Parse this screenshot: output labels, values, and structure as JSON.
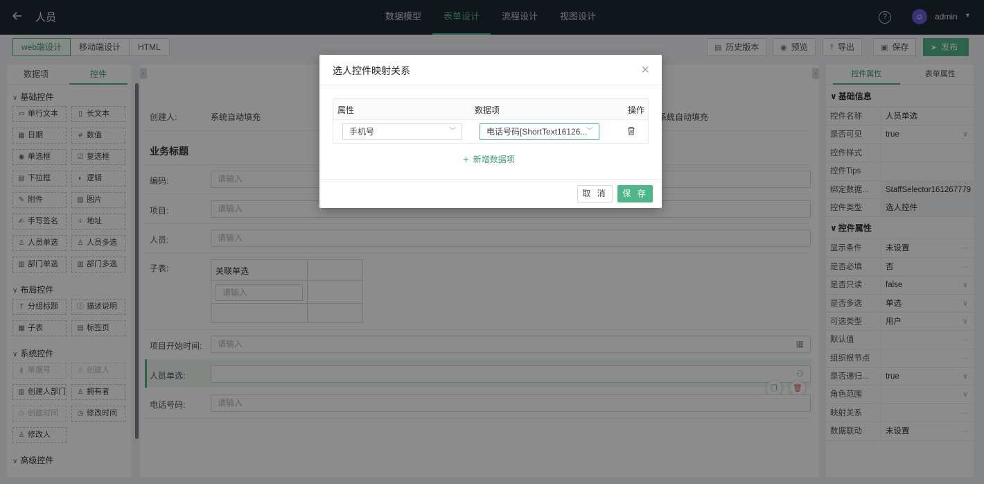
{
  "header": {
    "title": "人员",
    "tabs": [
      "数据模型",
      "表单设计",
      "流程设计",
      "视图设计"
    ],
    "active_tab_index": 1,
    "user": "admin"
  },
  "toolbar": {
    "modes": [
      "web端设计",
      "移动端设计",
      "HTML"
    ],
    "history": "历史版本",
    "preview": "预览",
    "export": "导出",
    "save": "保存",
    "publish": "发布"
  },
  "left_panel": {
    "tabs": [
      "数据项",
      "控件"
    ],
    "groups": [
      {
        "title": "基础控件",
        "items": [
          {
            "label": "单行文本",
            "icon": "text-line-icon"
          },
          {
            "label": "长文本",
            "icon": "text-area-icon"
          },
          {
            "label": "日期",
            "icon": "calendar-icon"
          },
          {
            "label": "数值",
            "icon": "number-icon"
          },
          {
            "label": "单选框",
            "icon": "radio-icon"
          },
          {
            "label": "复选框",
            "icon": "checkbox-icon"
          },
          {
            "label": "下拉框",
            "icon": "dropdown-icon"
          },
          {
            "label": "逻辑",
            "icon": "toggle-icon"
          },
          {
            "label": "附件",
            "icon": "paperclip-icon"
          },
          {
            "label": "图片",
            "icon": "image-icon"
          },
          {
            "label": "手写签名",
            "icon": "pen-icon"
          },
          {
            "label": "地址",
            "icon": "location-icon"
          },
          {
            "label": "人员单选",
            "icon": "person-icon"
          },
          {
            "label": "人员多选",
            "icon": "people-icon"
          },
          {
            "label": "部门单选",
            "icon": "department-icon"
          },
          {
            "label": "部门多选",
            "icon": "departments-icon"
          }
        ]
      },
      {
        "title": "布局控件",
        "items": [
          {
            "label": "分组标题",
            "icon": "heading-icon"
          },
          {
            "label": "描述说明",
            "icon": "info-icon"
          },
          {
            "label": "子表",
            "icon": "table-icon"
          },
          {
            "label": "标签页",
            "icon": "tabs-icon"
          }
        ]
      },
      {
        "title": "系统控件",
        "items": [
          {
            "label": "单据号",
            "icon": "barcode-icon",
            "disabled": true
          },
          {
            "label": "创建人",
            "icon": "person-icon",
            "disabled": true
          },
          {
            "label": "创建人部门",
            "icon": "department-icon"
          },
          {
            "label": "拥有者",
            "icon": "owner-icon"
          },
          {
            "label": "创建时间",
            "icon": "clock-icon",
            "disabled": true
          },
          {
            "label": "修改时间",
            "icon": "clock-edit-icon"
          },
          {
            "label": "修改人",
            "icon": "person-icon"
          }
        ]
      },
      {
        "title": "高级控件",
        "items": []
      }
    ]
  },
  "canvas": {
    "creator_label": "创建人:",
    "creator_value": "系统自动填充",
    "creator_value_right": "系统自动填充",
    "section_title": "业务标题",
    "code_label": "编码:",
    "project_label": "项目:",
    "person_label": "人员:",
    "subtable_label": "子表:",
    "subtable_header": "关联单选",
    "start_time_label": "项目开始时间:",
    "staff_single_label": "人员单选:",
    "phone_label": "电话号码:",
    "placeholder": "请输入"
  },
  "right_panel": {
    "tabs": [
      "控件属性",
      "表单属性"
    ],
    "sections": [
      {
        "title": "基础信息",
        "rows": [
          {
            "key": "控件名称",
            "value": "人员单选"
          },
          {
            "key": "是否可见",
            "value": "true",
            "suffix": "chevron"
          },
          {
            "key": "控件样式",
            "value": ""
          },
          {
            "key": "控件Tips",
            "value": ""
          },
          {
            "key": "绑定数据...",
            "value": "StaffSelector161267779",
            "shaded": true
          },
          {
            "key": "控件类型",
            "value": "选人控件",
            "shaded": true
          }
        ]
      },
      {
        "title": "控件属性",
        "rows": [
          {
            "key": "显示条件",
            "value": "未设置",
            "suffix": "dots"
          },
          {
            "key": "是否必填",
            "value": "否",
            "suffix": "dots"
          },
          {
            "key": "是否只读",
            "value": "false",
            "suffix": "chevron"
          },
          {
            "key": "是否多选",
            "value": "单选",
            "suffix": "chevron"
          },
          {
            "key": "可选类型",
            "value": "用户",
            "suffix": "chevron"
          },
          {
            "key": "默认值",
            "value": "",
            "suffix": "dots"
          },
          {
            "key": "组织根节点",
            "value": "",
            "suffix": "dots"
          },
          {
            "key": "是否递归...",
            "value": "true",
            "suffix": "chevron"
          },
          {
            "key": "角色范围",
            "value": "",
            "suffix": "chevron"
          },
          {
            "key": "映射关系",
            "value": "",
            "suffix": "dots"
          },
          {
            "key": "数据联动",
            "value": "未设置",
            "suffix": "dots"
          }
        ]
      }
    ]
  },
  "modal": {
    "title": "选人控件映射关系",
    "columns": [
      "属性",
      "数据项",
      "操作"
    ],
    "row": {
      "attribute": "手机号",
      "data_item": "电话号码[ShortText16126..."
    },
    "add_label": "新增数据项",
    "cancel_label": "取 消",
    "save_label": "保 存"
  },
  "colors": {
    "accent": "#4fb58a",
    "header_bg": "#1f2935"
  }
}
